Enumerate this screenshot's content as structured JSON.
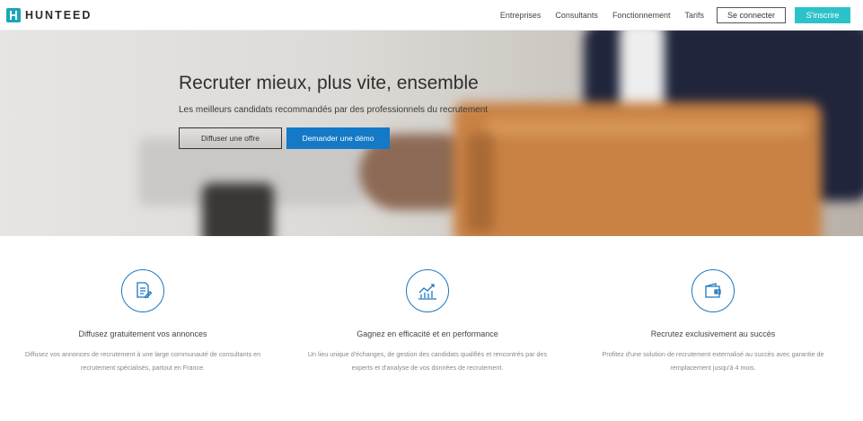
{
  "brand": {
    "name": "HUNTEED",
    "accent": "#2bc3c9",
    "primary": "#1479c6"
  },
  "nav": {
    "links": [
      "Entreprises",
      "Consultants",
      "Fonctionnement",
      "Tarifs"
    ],
    "login_label": "Se connecter",
    "signup_label": "S'inscrire"
  },
  "hero": {
    "title": "Recruter mieux, plus vite, ensemble",
    "subtitle": "Les meilleurs candidats recommandés par des professionnels du recrutement",
    "offer_button": "Diffuser une offre",
    "demo_button": "Demander une démo"
  },
  "features": [
    {
      "icon": "document-pen-icon",
      "title": "Diffusez gratuitement vos annonces",
      "desc_line1": "Diffusez vos annonces de recrutement à une large communauté de consultants en",
      "desc_line2": "recrutement spécialisés, partout en France."
    },
    {
      "icon": "chart-growth-icon",
      "title": "Gagnez en efficacité et en performance",
      "desc_line1": "Un lieu unique d'échanges, de gestion des candidats qualifiés et rencontrés par des",
      "desc_line2": "experts et d'analyse de vos données de recrutement."
    },
    {
      "icon": "wallet-icon",
      "title": "Recrutez exclusivement au succès",
      "desc_line1": "Profitez d'une solution de recrutement externalisé au succès avec garantie de",
      "desc_line2": "remplacement jusqu'à 4 mois."
    }
  ]
}
